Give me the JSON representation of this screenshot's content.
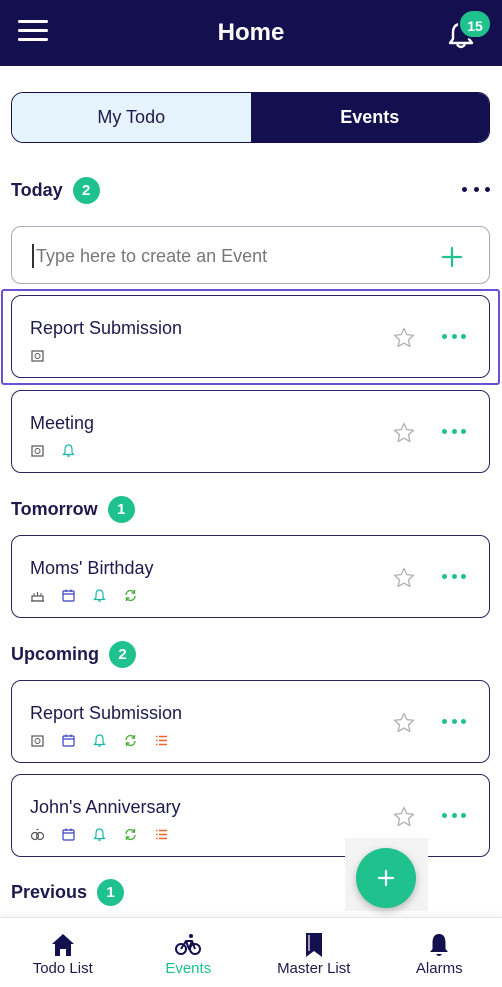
{
  "header": {
    "title": "Home",
    "notification_count": "15",
    "menu_icon": "hamburger-menu-icon",
    "bell_icon": "bell-icon"
  },
  "tabs": {
    "my_todo": "My Todo",
    "events": "Events",
    "active": "Events"
  },
  "colors": {
    "primary": "#14104f",
    "accent": "#1fc28c",
    "selected_outline": "#6b4fd6",
    "tab_inactive_bg": "#e5f3fd"
  },
  "create": {
    "placeholder": "Type here to create an Event"
  },
  "sections": {
    "today": {
      "label": "Today",
      "count": "2",
      "items": [
        {
          "title": "Report Submission",
          "icons": [
            "alarm-clock-icon"
          ]
        },
        {
          "title": "Meeting",
          "icons": [
            "alarm-clock-icon",
            "bell-icon"
          ]
        }
      ]
    },
    "tomorrow": {
      "label": "Tomorrow",
      "count": "1",
      "items": [
        {
          "title": "Moms' Birthday",
          "icons": [
            "birthday-cake-icon",
            "calendar-icon",
            "bell-icon",
            "repeat-icon"
          ]
        }
      ]
    },
    "upcoming": {
      "label": "Upcoming",
      "count": "2",
      "items": [
        {
          "title": "Report Submission",
          "icons": [
            "alarm-clock-icon",
            "calendar-icon",
            "bell-icon",
            "repeat-icon",
            "list-icon"
          ]
        },
        {
          "title": "John's Anniversary",
          "icons": [
            "rings-icon",
            "calendar-icon",
            "bell-icon",
            "repeat-icon",
            "list-icon"
          ]
        }
      ]
    },
    "previous": {
      "label": "Previous",
      "count": "1"
    }
  },
  "bottom_nav": [
    {
      "label": "Todo List",
      "icon": "home-icon"
    },
    {
      "label": "Events",
      "icon": "bicycle-icon",
      "active": true
    },
    {
      "label": "Master List",
      "icon": "bookmark-icon"
    },
    {
      "label": "Alarms",
      "icon": "bell-icon"
    }
  ]
}
